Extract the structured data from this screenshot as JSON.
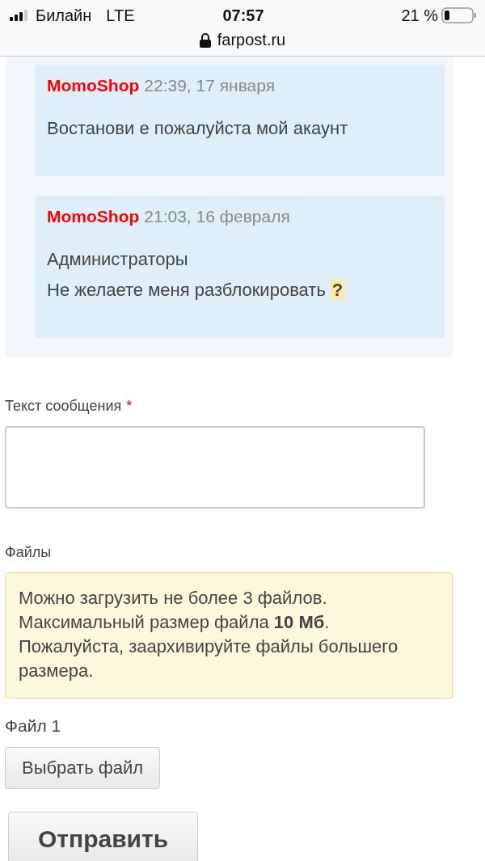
{
  "status_bar": {
    "carrier": "Билайн",
    "network": "LTE",
    "time": "07:57",
    "battery": "21 %"
  },
  "address_bar": {
    "url": "farpost.ru"
  },
  "messages": [
    {
      "author": "MomoShop",
      "date": "22:39, 17 января",
      "lines": [
        "Востанови е пожалуйста мой акаунт"
      ]
    },
    {
      "author": "MomoShop",
      "date": "21:03, 16 февраля",
      "lines": [
        "Администраторы",
        "Не желаете меня разблокировать"
      ],
      "mark": "?"
    }
  ],
  "form": {
    "message_label": "Текст сообщения",
    "required_mark": "*",
    "files_label": "Файлы",
    "notice": "Можно загрузить не более 3 файлов. Максимальный размер файла **10 Мб**. Пожалуйста, заархивируйте файлы большего размера.",
    "file_label": "Файл 1",
    "choose_button": "Выбрать файл",
    "submit_button": "Отправить"
  }
}
